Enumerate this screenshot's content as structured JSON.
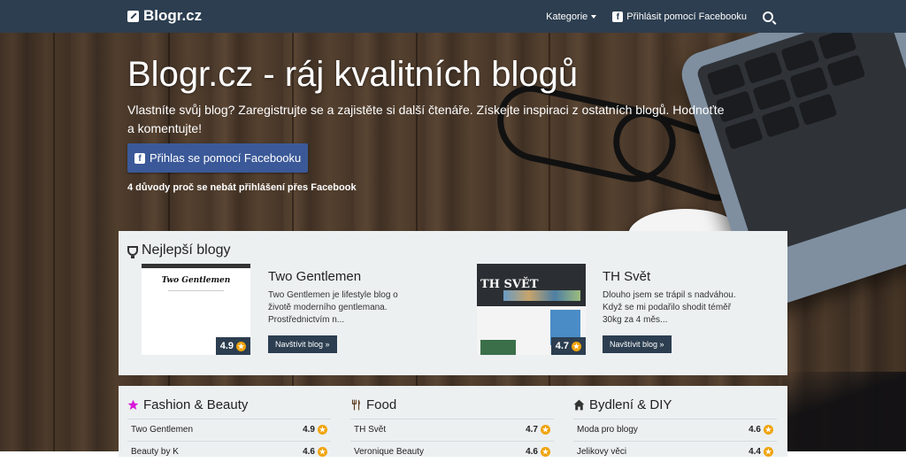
{
  "navbar": {
    "brand": "Blogr.cz",
    "categories_label": "Kategorie",
    "login_label": "Přihlásit pomocí Facebooku"
  },
  "hero": {
    "title": "Blogr.cz - ráj kvalitních blogů",
    "subtitle": "Vlastníte svůj blog? Zaregistrujte se a zajistěte si další čtenáře. Získejte inspiraci z ostatních blogů. Hodnoťte a komentujte!",
    "fb_button": "Přihlas se pomocí Facebooku",
    "reasons_link": "4 důvody proč se nebát přihlášení přes Facebook"
  },
  "best": {
    "title": "Nejlepší blogy",
    "cards": [
      {
        "title": "Two Gentlemen",
        "text": "Two Gentlemen je lifestyle blog o životě moderního gentlemana. Prostřednictvím n...",
        "rating": "4.9",
        "button": "Navštívit blog »",
        "thumb_logo": "Two Gentlemen"
      },
      {
        "title": "TH Svět",
        "text": "Dlouho jsem se trápil s nadváhou. Když se mi podařilo shodit téměř 30kg za 4 měs...",
        "rating": "4.7",
        "button": "Navštívit blog »",
        "thumb_logo": "TH SVĚT"
      }
    ]
  },
  "categories": [
    {
      "title": "Fashion & Beauty",
      "icon": "star-icon",
      "color": "#d91ad9",
      "rows": [
        {
          "name": "Two Gentlemen",
          "score": "4.9"
        },
        {
          "name": "Beauty by K",
          "score": "4.6"
        }
      ]
    },
    {
      "title": "Food",
      "icon": "cutlery-icon",
      "color": "#333333",
      "rows": [
        {
          "name": "TH Svět",
          "score": "4.7"
        },
        {
          "name": "Veronique Beauty",
          "score": "4.6"
        }
      ]
    },
    {
      "title": "Bydlení & DIY",
      "icon": "home-icon",
      "color": "#333333",
      "rows": [
        {
          "name": "Moda pro blogy",
          "score": "4.6"
        },
        {
          "name": "Jelikovy věci",
          "score": "4.4"
        }
      ]
    }
  ],
  "colors": {
    "navbar": "#2c3e50",
    "facebook": "#3b5998",
    "panel": "#ecf0f1",
    "star": "#f0a30a"
  }
}
